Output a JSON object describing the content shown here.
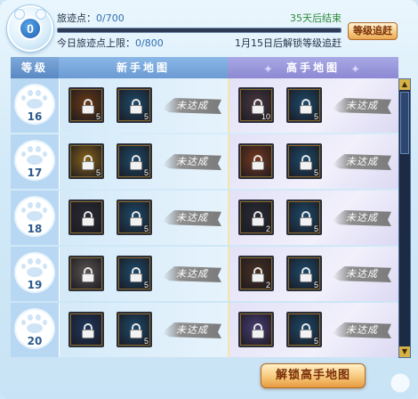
{
  "header": {
    "points_label": "旅迹点：",
    "points_value": "0/700",
    "end_text": "35天后结束",
    "daily_label": "今日旅迹点上限：",
    "daily_value": "0/800",
    "unlock_notice": "1月15日后解锁等级追赶",
    "badge_value": "0",
    "chase_button": "等级追赶",
    "progress": 0
  },
  "columns": {
    "level": "等级",
    "novice": "新手地图",
    "expert": "高手地图"
  },
  "status_text": "未达成",
  "rows": [
    {
      "level": "16",
      "novice": [
        {
          "icon": "gold-coin-icon",
          "count": "5",
          "bg": "#6b3a12"
        },
        {
          "icon": "ticket-icon",
          "count": "5",
          "bg": "#1d4a6a"
        }
      ],
      "expert": [
        {
          "icon": "silver-coin-icon",
          "count": "10",
          "bg": "#4a3840"
        },
        {
          "icon": "ticket-icon",
          "count": "5",
          "bg": "#1d4a6a"
        }
      ]
    },
    {
      "level": "17",
      "novice": [
        {
          "icon": "gold-box-icon",
          "count": "5",
          "bg": "#8a6418"
        },
        {
          "icon": "ticket-icon",
          "count": "5",
          "bg": "#1d4a6a"
        }
      ],
      "expert": [
        {
          "icon": "gift-chest-icon",
          "count": "",
          "bg": "#7a3a1e"
        },
        {
          "icon": "ticket-icon",
          "count": "5",
          "bg": "#1d4a6a"
        }
      ]
    },
    {
      "level": "18",
      "novice": [
        {
          "icon": "dark-ore-icon",
          "count": "",
          "bg": "#2a2a33"
        },
        {
          "icon": "ticket-icon",
          "count": "5",
          "bg": "#1d4a6a"
        }
      ],
      "expert": [
        {
          "icon": "dark-ore-icon",
          "count": "2",
          "bg": "#2a2a33"
        },
        {
          "icon": "ticket-icon",
          "count": "5",
          "bg": "#1d4a6a"
        }
      ]
    },
    {
      "level": "19",
      "novice": [
        {
          "icon": "grey-stone-icon",
          "count": "",
          "bg": "#5b5552"
        },
        {
          "icon": "ticket-icon",
          "count": "5",
          "bg": "#1d4a6a"
        }
      ],
      "expert": [
        {
          "icon": "brown-stone-icon",
          "count": "2",
          "bg": "#4a3020"
        },
        {
          "icon": "ticket-icon",
          "count": "5",
          "bg": "#1d4a6a"
        }
      ]
    },
    {
      "level": "20",
      "novice": [
        {
          "icon": "spirit-beast-icon",
          "count": "",
          "bg": "#1f3760"
        },
        {
          "icon": "ticket-icon",
          "count": "5",
          "bg": "#1d4a6a"
        }
      ],
      "expert": [
        {
          "icon": "white-beast-icon",
          "count": "",
          "bg": "#4b3d74"
        },
        {
          "icon": "ticket-icon",
          "count": "5",
          "bg": "#1d4a6a"
        }
      ]
    }
  ],
  "unlock_button": "解锁高手地图",
  "colors": {
    "accent_blue": "#2f6fb0",
    "green_text": "#2e8b3a",
    "button_orange": "#f7c87b"
  }
}
